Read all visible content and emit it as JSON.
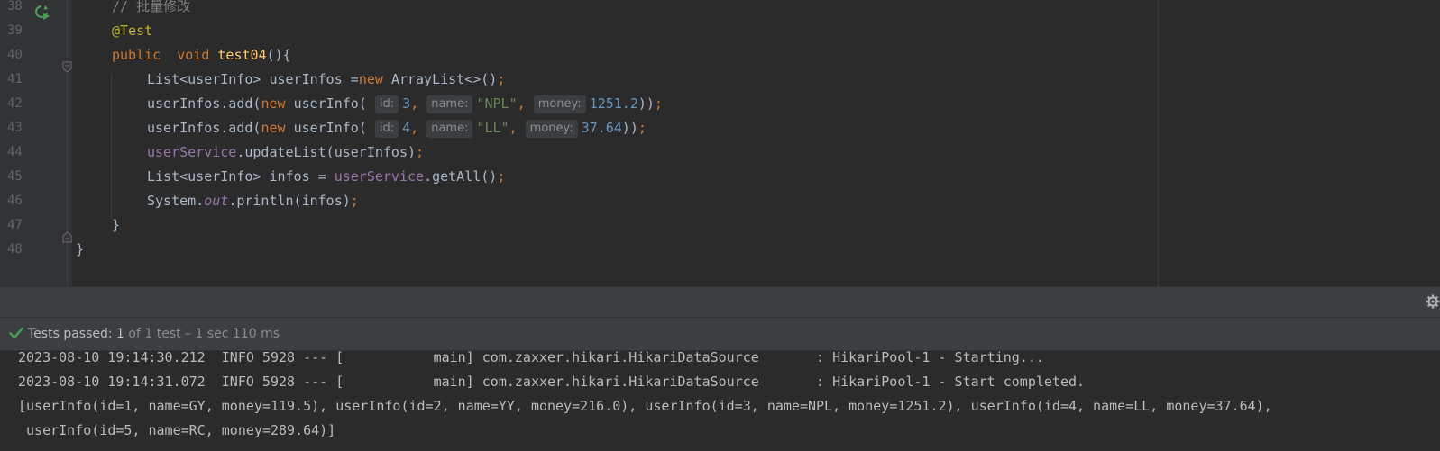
{
  "editor": {
    "lines": [
      {
        "num": "38",
        "tokens": [
          [
            "cmt",
            "// 批量修改"
          ]
        ]
      },
      {
        "num": "39",
        "tokens": [
          [
            "ann",
            "@Test"
          ]
        ]
      },
      {
        "num": "40",
        "tokens": [
          [
            "kw",
            "public  void "
          ],
          [
            "fn",
            "test04"
          ],
          [
            "txt",
            "(){"
          ]
        ]
      },
      {
        "num": "41",
        "tokens": [
          [
            "txt",
            "List<userInfo> userInfos ="
          ],
          [
            "kw",
            "new "
          ],
          [
            "txt",
            "ArrayList<>()"
          ],
          [
            "kw",
            ";"
          ]
        ]
      },
      {
        "num": "42",
        "tokens": [
          [
            "txt",
            "userInfos.add("
          ],
          [
            "kw",
            "new "
          ],
          [
            "txt",
            "userInfo( "
          ],
          [
            "hint",
            "id:"
          ],
          [
            "num",
            "3"
          ],
          [
            "kw",
            ", "
          ],
          [
            "hint",
            "name:"
          ],
          [
            "str",
            "\"NPL\""
          ],
          [
            "kw",
            ", "
          ],
          [
            "hint",
            "money:"
          ],
          [
            "num",
            "1251.2"
          ],
          [
            "txt",
            "))"
          ],
          [
            "kw",
            ";"
          ]
        ]
      },
      {
        "num": "43",
        "tokens": [
          [
            "txt",
            "userInfos.add("
          ],
          [
            "kw",
            "new "
          ],
          [
            "txt",
            "userInfo( "
          ],
          [
            "hint",
            "id:"
          ],
          [
            "num",
            "4"
          ],
          [
            "kw",
            ", "
          ],
          [
            "hint",
            "name:"
          ],
          [
            "str",
            "\"LL\""
          ],
          [
            "kw",
            ", "
          ],
          [
            "hint",
            "money:"
          ],
          [
            "num",
            "37.64"
          ],
          [
            "txt",
            "))"
          ],
          [
            "kw",
            ";"
          ]
        ]
      },
      {
        "num": "44",
        "tokens": [
          [
            "fld",
            "userService"
          ],
          [
            "txt",
            ".updateList(userInfos)"
          ],
          [
            "kw",
            ";"
          ]
        ]
      },
      {
        "num": "45",
        "tokens": [
          [
            "txt",
            "List<userInfo> infos = "
          ],
          [
            "fld",
            "userService"
          ],
          [
            "txt",
            ".getAll()"
          ],
          [
            "kw",
            ";"
          ]
        ]
      },
      {
        "num": "46",
        "tokens": [
          [
            "txt",
            "System."
          ],
          [
            "ital",
            "out"
          ],
          [
            "txt",
            ".println(infos)"
          ],
          [
            "kw",
            ";"
          ]
        ]
      },
      {
        "num": "47",
        "tokens": [
          [
            "txt",
            "}"
          ]
        ]
      },
      {
        "num": "48",
        "tokens": [
          [
            "txt",
            "}"
          ]
        ]
      }
    ]
  },
  "tests": {
    "status_prefix": "Tests passed: ",
    "passed_count": "1",
    "status_suffix": " of 1 test – 1 sec 110 ms"
  },
  "console": {
    "lines": [
      "2023-08-10 19:14:30.212  INFO 5928 --- [           main] com.zaxxer.hikari.HikariDataSource       : HikariPool-1 - Starting...",
      "2023-08-10 19:14:31.072  INFO 5928 --- [           main] com.zaxxer.hikari.HikariDataSource       : HikariPool-1 - Start completed.",
      "[userInfo(id=1, name=GY, money=119.5), userInfo(id=2, name=YY, money=216.0), userInfo(id=3, name=NPL, money=1251.2), userInfo(id=4, name=LL, money=37.64),",
      " userInfo(id=5, name=RC, money=289.64)]"
    ]
  },
  "icons": {
    "run": "run-test-icon",
    "fold": "fold-marker-icon",
    "gear": "gear-icon",
    "check": "check-icon"
  },
  "colors": {
    "background": "#2b2b2b",
    "keyword": "#cc7832",
    "annotation": "#bbb529",
    "function": "#ffc66d",
    "string": "#6a8759",
    "number": "#6897bb",
    "field": "#9876aa",
    "passed": "#499c54"
  }
}
